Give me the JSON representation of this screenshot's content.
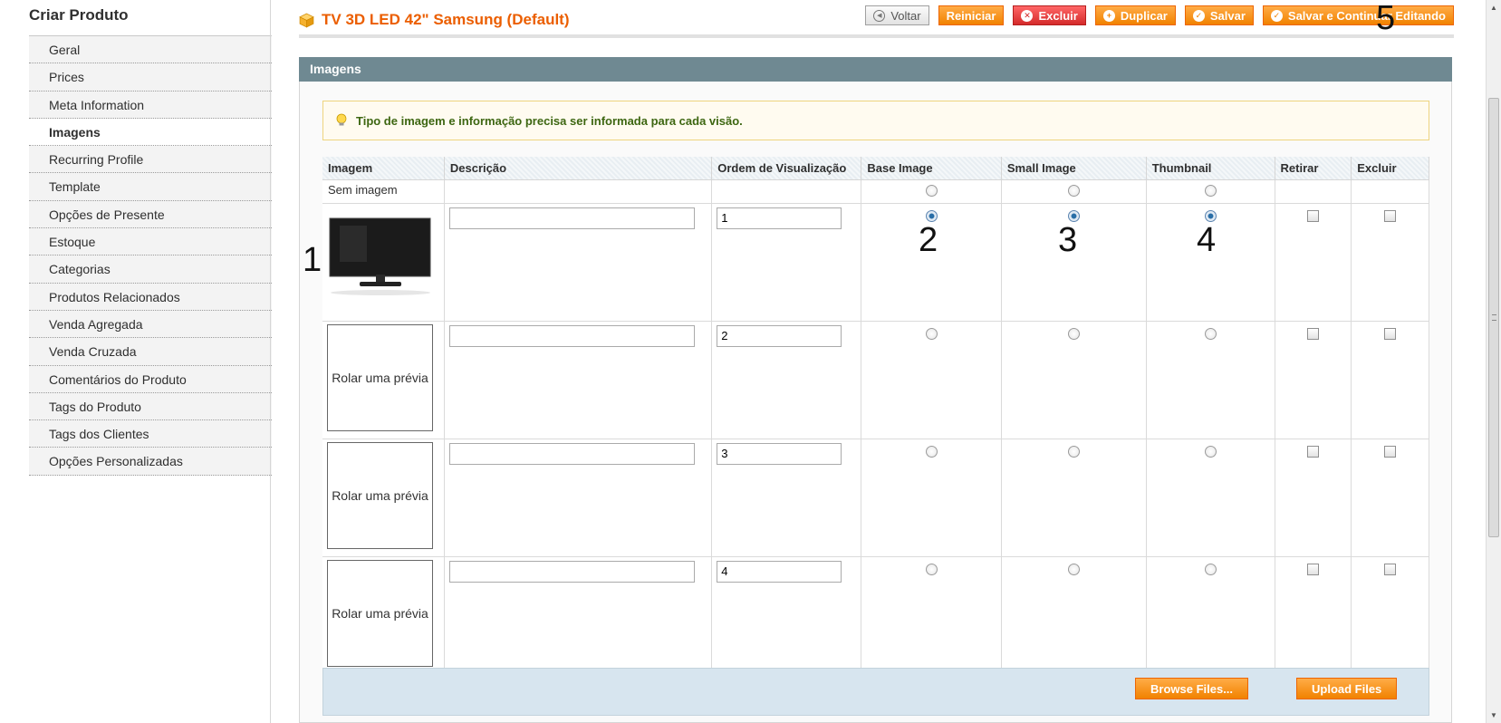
{
  "sidebar": {
    "title": "Criar Produto",
    "items": [
      {
        "label": "Geral"
      },
      {
        "label": "Prices"
      },
      {
        "label": "Meta Information"
      },
      {
        "label": "Imagens"
      },
      {
        "label": "Recurring Profile"
      },
      {
        "label": "Template"
      },
      {
        "label": "Opções de Presente"
      },
      {
        "label": "Estoque"
      },
      {
        "label": "Categorias"
      },
      {
        "label": "Produtos Relacionados"
      },
      {
        "label": "Venda Agregada"
      },
      {
        "label": "Venda Cruzada"
      },
      {
        "label": "Comentários do Produto"
      },
      {
        "label": "Tags do Produto"
      },
      {
        "label": "Tags dos Clientes"
      },
      {
        "label": "Opções Personalizadas"
      }
    ],
    "active_index": 3
  },
  "header": {
    "title": "TV 3D LED 42\" Samsung (Default)",
    "buttons": {
      "back": "Voltar",
      "reset": "Reiniciar",
      "delete": "Excluir",
      "duplicate": "Duplicar",
      "save": "Salvar",
      "save_continue": "Salvar e Continuar Editando"
    }
  },
  "annotations": {
    "a1": "1",
    "a2": "2",
    "a3": "3",
    "a4": "4",
    "a5": "5"
  },
  "panel": {
    "title": "Imagens",
    "notice": "Tipo de imagem e informação precisa ser informada para cada visão.",
    "columns": {
      "image": "Imagem",
      "description": "Descrição",
      "order": "Ordem de Visualização",
      "base": "Base Image",
      "small": "Small Image",
      "thumbnail": "Thumbnail",
      "remove": "Retirar",
      "delete": "Excluir"
    },
    "no_image_label": "Sem imagem",
    "preview_label": "Rolar uma prévia",
    "rows": [
      {
        "order": "1",
        "description": ""
      },
      {
        "order": "2",
        "description": ""
      },
      {
        "order": "3",
        "description": ""
      },
      {
        "order": "4",
        "description": ""
      }
    ],
    "browse_label": "Browse Files...",
    "upload_label": "Upload Files"
  },
  "colors": {
    "accent": "#eb5e00",
    "button": "#f18200",
    "panel_header": "#6f8992",
    "notice_text": "#3d6611"
  }
}
